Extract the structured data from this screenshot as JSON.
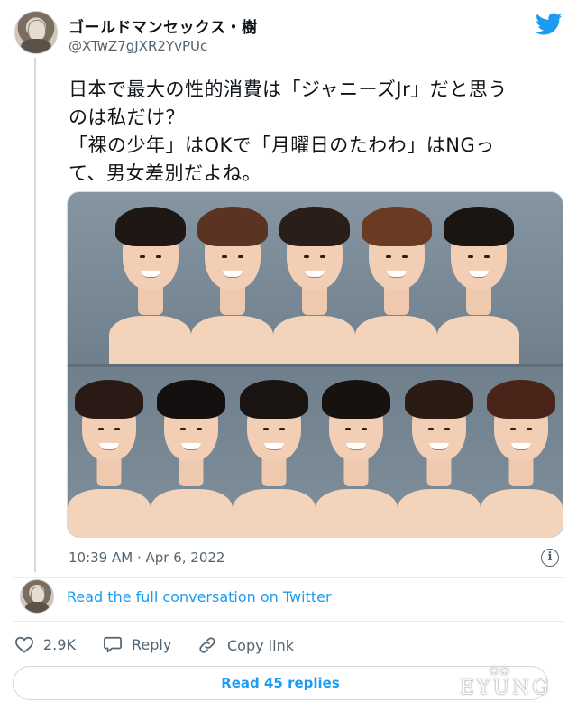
{
  "author": {
    "display_name": "ゴールドマンセックス・樹",
    "handle": "@XTwZ7gJXR2YvPUc"
  },
  "tweet": {
    "lines": [
      "日本で最大の性的消費は「ジャニーズJr」だと思う",
      "のは私だけ？",
      "「裸の少年」はOKで「月曜日のたわわ」はNGっ",
      "て、男女差別だよね。"
    ],
    "timestamp": "10:39 AM · Apr 6, 2022"
  },
  "media": {
    "top_row": [
      {
        "hair": "#1e1714"
      },
      {
        "hair": "#5a3322"
      },
      {
        "hair": "#2a1e18"
      },
      {
        "hair": "#6b3a22"
      },
      {
        "hair": "#1b1512"
      }
    ],
    "bottom_row": [
      {
        "hair": "#2a1a15"
      },
      {
        "hair": "#141010"
      },
      {
        "hair": "#1a1412"
      },
      {
        "hair": "#171210"
      },
      {
        "hair": "#2b1b15"
      },
      {
        "hair": "#4a2418"
      }
    ]
  },
  "conversation": {
    "link_text": "Read the full conversation on Twitter"
  },
  "actions": {
    "like_count": "2.9K",
    "reply_label": "Reply",
    "copy_label": "Copy link"
  },
  "replies_button": "Read 45 replies",
  "watermark": "EYUNG",
  "colors": {
    "twitter_blue": "#1d9bf0",
    "secondary_text": "#536471",
    "divider": "#e7ecf0"
  }
}
